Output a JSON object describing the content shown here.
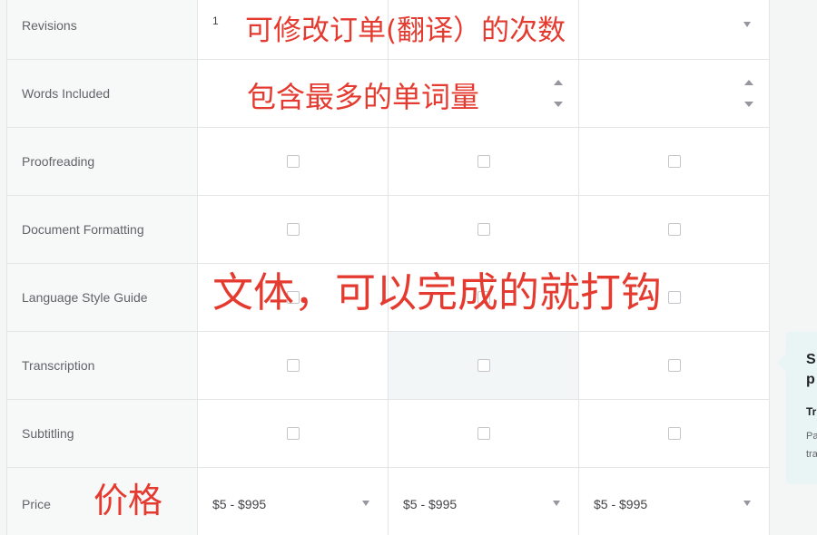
{
  "rows": {
    "revisions": {
      "label": "Revisions",
      "values": [
        "1"
      ]
    },
    "words_included": {
      "label": "Words Included"
    },
    "proofreading": {
      "label": "Proofreading"
    },
    "document_formatting": {
      "label": "Document Formatting"
    },
    "language_style_guide": {
      "label": "Language Style Guide"
    },
    "transcription": {
      "label": "Transcription"
    },
    "subtitling": {
      "label": "Subtitling"
    },
    "price": {
      "label": "Price",
      "values": [
        "$5 - $995",
        "$5 - $995",
        "$5 - $995"
      ]
    }
  },
  "annotations": {
    "revisions": "可修改订单(翻译）的次数",
    "words": "包含最多的单词量",
    "features": "文体，可以完成的就打钩",
    "price": "价格"
  },
  "tooltip": {
    "title_line1": "S",
    "title_line2": "p",
    "subtitle": "Tr",
    "body_line1": "Pa",
    "body_line2": "tra"
  },
  "colors": {
    "annotation": "#e53a2f",
    "tooltip_bg": "#e9f4f4",
    "label_bg": "#f7f8f8",
    "border": "#e3e5e6"
  },
  "icons": {
    "dropdown": "chevron-down-icon",
    "stepper": "stepper-arrows-icon",
    "checkbox": "checkbox-icon"
  }
}
